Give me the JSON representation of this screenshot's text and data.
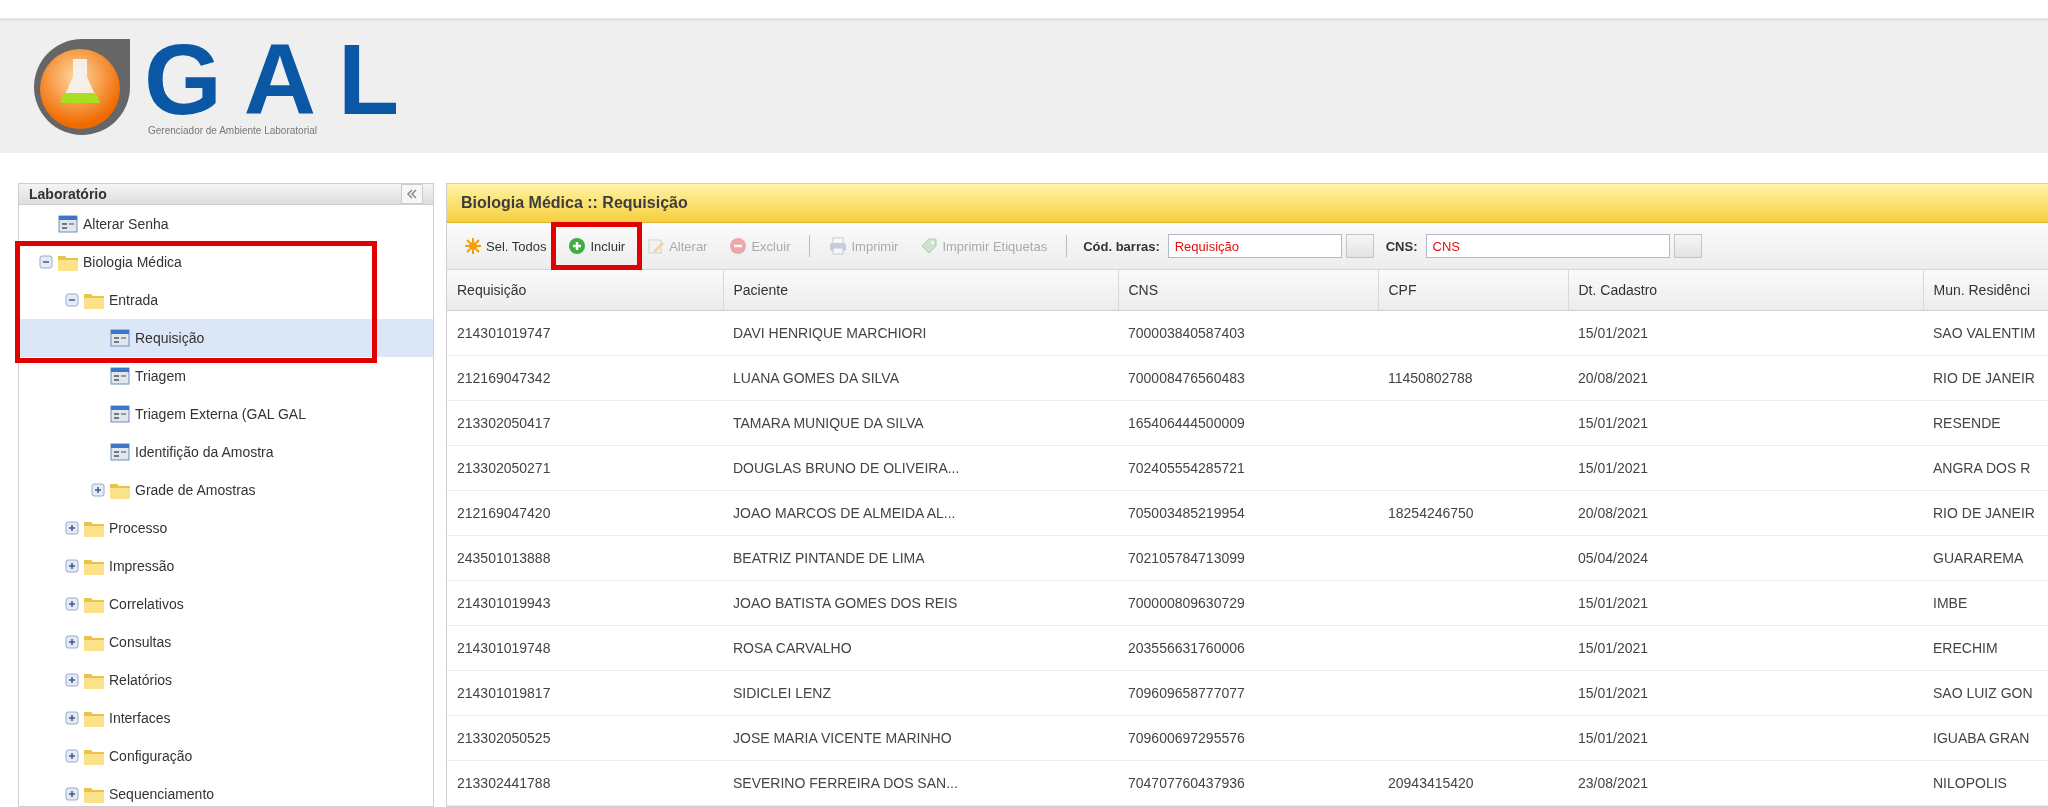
{
  "logo": {
    "title": "GAL",
    "subtitle": "Gerenciador de Ambiente Laboratorial"
  },
  "sidebar": {
    "title": "Laboratório",
    "tree": [
      {
        "label": "Alterar Senha",
        "kind": "page",
        "selected": false,
        "highlighted": false
      },
      {
        "label": "Biologia Médica",
        "kind": "folder",
        "expanded": true,
        "selected": false,
        "highlighted": true,
        "children": [
          {
            "label": "Entrada",
            "kind": "folder",
            "expanded": true,
            "selected": false,
            "highlighted": true,
            "children": [
              {
                "label": "Requisição",
                "kind": "page",
                "selected": true,
                "highlighted": true
              },
              {
                "label": "Triagem",
                "kind": "page",
                "selected": false,
                "highlighted": false
              },
              {
                "label": "Triagem Externa (GAL GAL",
                "kind": "page",
                "selected": false,
                "highlighted": false
              },
              {
                "label": "Identifição da Amostra",
                "kind": "page",
                "selected": false,
                "highlighted": false
              },
              {
                "label": "Grade de Amostras",
                "kind": "folder",
                "expanded": false,
                "selected": false,
                "highlighted": false
              }
            ]
          },
          {
            "label": "Processo",
            "kind": "folder",
            "expanded": false,
            "selected": false,
            "highlighted": false
          },
          {
            "label": "Impressão",
            "kind": "folder",
            "expanded": false,
            "selected": false,
            "highlighted": false
          },
          {
            "label": "Correlativos",
            "kind": "folder",
            "expanded": false,
            "selected": false,
            "highlighted": false
          },
          {
            "label": "Consultas",
            "kind": "folder",
            "expanded": false,
            "selected": false,
            "highlighted": false
          },
          {
            "label": "Relatórios",
            "kind": "folder",
            "expanded": false,
            "selected": false,
            "highlighted": false
          },
          {
            "label": "Interfaces",
            "kind": "folder",
            "expanded": false,
            "selected": false,
            "highlighted": false
          },
          {
            "label": "Configuração",
            "kind": "folder",
            "expanded": false,
            "selected": false,
            "highlighted": false
          },
          {
            "label": "Sequenciamento",
            "kind": "folder",
            "expanded": false,
            "selected": false,
            "highlighted": false
          }
        ]
      }
    ]
  },
  "panel": {
    "title": "Biologia Médica :: Requisição",
    "toolbar": [
      {
        "kind": "button",
        "label": "Sel. Todos",
        "disabled": false,
        "highlighted": false
      },
      {
        "kind": "button",
        "label": "Incluir",
        "disabled": false,
        "highlighted": true
      },
      {
        "kind": "button",
        "label": "Alterar",
        "disabled": true,
        "highlighted": false
      },
      {
        "kind": "button",
        "label": "Excluir",
        "disabled": true,
        "highlighted": false
      },
      {
        "kind": "separator"
      },
      {
        "kind": "button",
        "label": "Imprimir",
        "disabled": true,
        "highlighted": false
      },
      {
        "kind": "button",
        "label": "Imprimir Etiquetas",
        "disabled": true,
        "highlighted": false
      },
      {
        "kind": "separator"
      },
      {
        "kind": "field",
        "label": "Cód. barras:",
        "placeholder": "Requisição"
      },
      {
        "kind": "field",
        "label": "CNS:",
        "placeholder": "CNS"
      }
    ],
    "table": {
      "columns": [
        "Requisição",
        "Paciente",
        "CNS",
        "CPF",
        "Dt. Cadastro",
        "Mun. Residênci"
      ],
      "rows": [
        [
          "214301019747",
          "DAVI HENRIQUE MARCHIORI",
          "700003840587403",
          null,
          "15/01/2021",
          "SAO VALENTIM"
        ],
        [
          "212169047342",
          "LUANA GOMES DA SILVA",
          "700008476560483",
          "11450802788",
          "20/08/2021",
          "RIO DE JANEIR"
        ],
        [
          "213302050417",
          "TAMARA MUNIQUE DA SILVA",
          "165406444500009",
          null,
          "15/01/2021",
          "RESENDE"
        ],
        [
          "213302050271",
          "DOUGLAS BRUNO DE OLIVEIRA...",
          "702405554285721",
          null,
          "15/01/2021",
          "ANGRA DOS R"
        ],
        [
          "212169047420",
          "JOAO MARCOS DE ALMEIDA AL...",
          "705003485219954",
          "18254246750",
          "20/08/2021",
          "RIO DE JANEIR"
        ],
        [
          "243501013888",
          "BEATRIZ PINTANDE DE LIMA",
          "702105784713099",
          null,
          "05/04/2024",
          "GUARAREMA"
        ],
        [
          "214301019943",
          "JOAO BATISTA GOMES DOS REIS",
          "700000809630729",
          null,
          "15/01/2021",
          "IMBE"
        ],
        [
          "214301019748",
          "ROSA CARVALHO",
          "203556631760006",
          null,
          "15/01/2021",
          "ERECHIM"
        ],
        [
          "214301019817",
          "SIDICLEI LENZ",
          "709609658777077",
          null,
          "15/01/2021",
          "SAO LUIZ GON"
        ],
        [
          "213302050525",
          "JOSE MARIA VICENTE MARINHO",
          "709600697295576",
          null,
          "15/01/2021",
          "IGUABA GRAN"
        ],
        [
          "213302441788",
          "SEVERINO FERREIRA DOS SAN...",
          "704707760437936",
          "20943415420",
          "23/08/2021",
          "NILOPOLIS"
        ]
      ]
    }
  }
}
